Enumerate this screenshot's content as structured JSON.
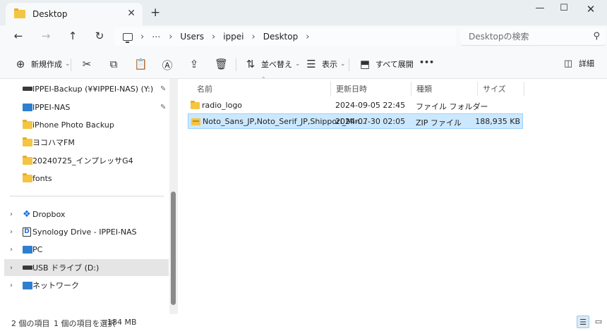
{
  "window": {
    "tab_title": "Desktop",
    "tab_close": "✕",
    "new_tab": "+",
    "minimize": "—",
    "maximize": "☐",
    "close": "✕"
  },
  "nav": {
    "back": "←",
    "forward": "→",
    "up": "↑",
    "refresh": "↻",
    "breadcrumb": [
      "Users",
      "ippei",
      "Desktop"
    ],
    "overflow": "⋯",
    "search_placeholder": "Desktopの検索"
  },
  "toolbar": {
    "new_label": "新規作成",
    "sort_label": "並べ替え",
    "view_label": "表示",
    "extract_label": "すべて展開",
    "more": "•••",
    "details_label": "詳細"
  },
  "sidebar": {
    "pinned": [
      {
        "label": "IPPEI-Backup (¥¥IPPEI-NAS) (Y:)",
        "icon": "drive",
        "pinned": true
      },
      {
        "label": "IPPEI-NAS",
        "icon": "monitor",
        "pinned": true
      },
      {
        "label": "iPhone Photo Backup",
        "icon": "folder",
        "pinned": false
      },
      {
        "label": "ヨコハマFM",
        "icon": "folder",
        "pinned": false
      },
      {
        "label": "20240725_インプレッサG4",
        "icon": "folder",
        "pinned": false
      },
      {
        "label": "fonts",
        "icon": "folder",
        "pinned": false
      }
    ],
    "locations": [
      {
        "label": "Dropbox",
        "icon": "dropbox"
      },
      {
        "label": "Synology Drive - IPPEI-NAS",
        "icon": "synology"
      },
      {
        "label": "PC",
        "icon": "pc"
      },
      {
        "label": "USB ドライブ (D:)",
        "icon": "usb-drive",
        "selected": true
      },
      {
        "label": "ネットワーク",
        "icon": "network"
      }
    ],
    "pin_glyph": "📌",
    "expand_glyph": "›"
  },
  "columns": {
    "name": "名前",
    "date": "更新日時",
    "type": "種類",
    "size": "サイズ"
  },
  "files": [
    {
      "name": "radio_logo",
      "date": "2024-09-05 22:45",
      "type": "ファイル フォルダー",
      "size": "",
      "icon": "folder",
      "selected": false
    },
    {
      "name": "Noto_Sans_JP,Noto_Serif_JP,Shippori_Min...",
      "date": "2024-07-30 02:05",
      "type": "ZIP ファイル",
      "size": "188,935 KB",
      "icon": "zip-folder",
      "selected": true
    }
  ],
  "status": {
    "item_count": "2 個の項目",
    "selection": "1 個の項目を選択",
    "selection_size": "184 MB"
  }
}
